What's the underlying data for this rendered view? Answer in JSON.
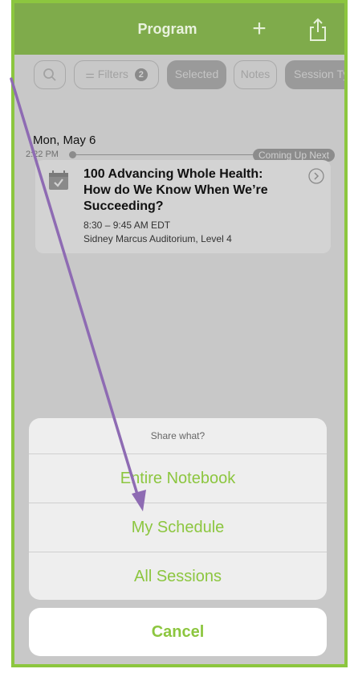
{
  "navbar": {
    "title": "Program",
    "plus_icon": "plus-icon",
    "share_icon": "share-icon"
  },
  "filters": {
    "search_icon": "search-icon",
    "filters_label": "Filters",
    "filters_count": "2",
    "selected_label": "Selected",
    "notes_label": "Notes",
    "session_label": "Session Ty"
  },
  "schedule": {
    "date": "Mon, May 6",
    "current_time": "2:22 PM",
    "coming_up": "Coming Up Next",
    "session": {
      "title": "100 Advancing Whole Health: How do We Know When We’re Succeeding?",
      "time": "8:30 – 9:45 AM EDT",
      "location": "Sidney Marcus Auditorium, Level 4"
    }
  },
  "share_sheet": {
    "title": "Share what?",
    "options": [
      "Entire Notebook",
      "My Schedule",
      "All Sessions"
    ],
    "cancel": "Cancel"
  },
  "colors": {
    "accent": "#8cc63f",
    "navbar": "#7fab4b",
    "arrow": "#8e6bb3"
  }
}
